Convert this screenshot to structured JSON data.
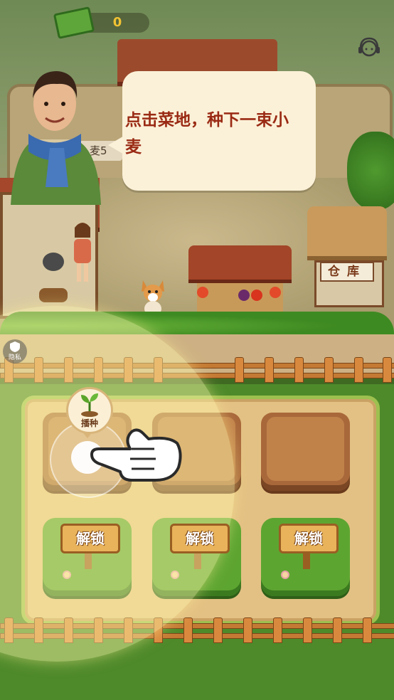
{
  "hud": {
    "cash_value": "0",
    "cash_icon": "cash-stack-icon",
    "support_icon": "customer-service-icon"
  },
  "tutorial": {
    "line1": "点击菜地，种下一束小",
    "line2": "麦"
  },
  "background": {
    "partial_label": "麦5",
    "warehouse_sign": "仓库"
  },
  "privacy": {
    "label": "隐私",
    "icon": "shield-icon"
  },
  "seed_action": {
    "label": "播种",
    "icon": "sprout-icon"
  },
  "plots": {
    "unlock_labels": [
      "解锁",
      "解锁",
      "解锁"
    ]
  },
  "colors": {
    "bubble_text": "#9a2a14",
    "cash_text": "#f2c233",
    "grass": "#4e8a2a",
    "soil": "#a9683a"
  }
}
